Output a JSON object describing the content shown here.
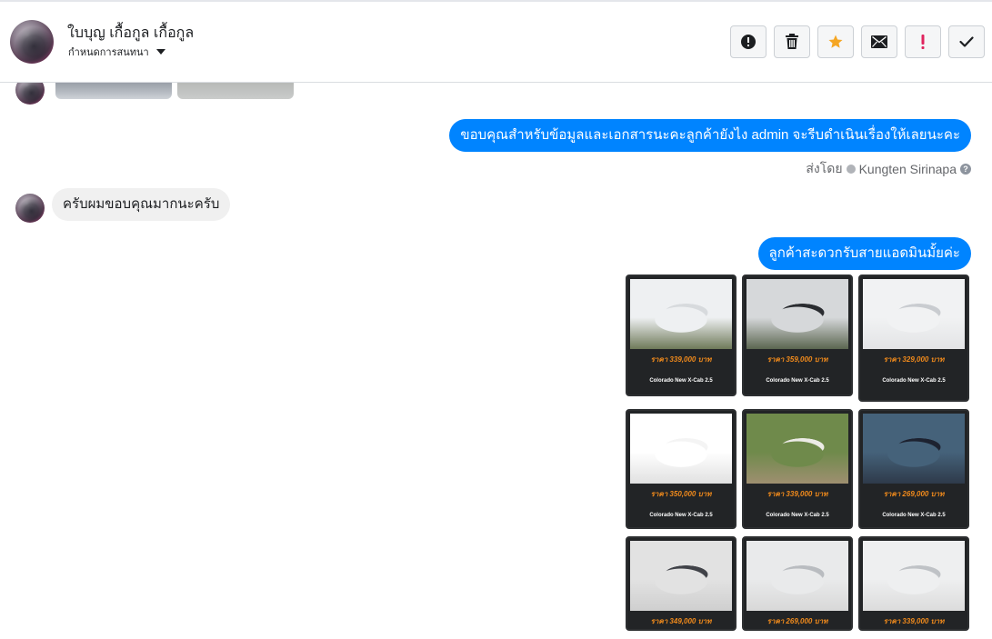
{
  "header": {
    "contact_name": "ใบบุญ เกื้อกูล เกื้อกูล",
    "assign_label": "กำหนดการสนทนา",
    "actions": [
      {
        "name": "report-button",
        "icon": "exclamation-circle-icon",
        "color": "#1c1e21"
      },
      {
        "name": "delete-button",
        "icon": "trash-icon",
        "color": "#1c1e21"
      },
      {
        "name": "star-button",
        "icon": "star-icon",
        "color": "#f5a623"
      },
      {
        "name": "mark-unread-button",
        "icon": "envelope-icon",
        "color": "#1c1e21"
      },
      {
        "name": "priority-button",
        "icon": "exclamation-icon",
        "color": "#e0245e"
      },
      {
        "name": "done-button",
        "icon": "check-icon",
        "color": "#1c1e21"
      }
    ]
  },
  "messages": {
    "outgoing_1": "ขอบคุณสำหรับข้อมูลและเอกสารนะคะลูกค้ายังไง admin จะรีบดำเนินเรื่องให้เลยนะคะ",
    "sent_by_prefix": "ส่งโดย",
    "sent_by_name": "Kungten Sirinapa",
    "incoming_1": "ครับผมขอบคุณมากนะครับ",
    "outgoing_2": "ลูกค้าสะดวกรับสายแอดมินมั้ยค่ะ"
  },
  "car_cards": [
    {
      "price": "ราคา 339,000 บาท",
      "model": "Colorado New X-Cab 2.5",
      "photo_colors": [
        "#d7dadd",
        "#eef0f2",
        "#6f7a5a"
      ]
    },
    {
      "price": "ราคา 359,000 บาท",
      "model": "Colorado New X-Cab 2.5",
      "photo_colors": [
        "#2a2c30",
        "#d6d8da",
        "#5b6650"
      ]
    },
    {
      "price": "ราคา 329,000 บาท",
      "model": "Colorado New X-Cab 2.5",
      "photo_colors": [
        "#c9ccd0",
        "#f1f2f3",
        "#e3e4e6"
      ]
    },
    {
      "price": "ราคา 350,000 บาท",
      "model": "Colorado New X-Cab 2.5",
      "photo_colors": [
        "#f4f4f4",
        "#ffffff",
        "#e1e1e1"
      ]
    },
    {
      "price": "ราคา 339,000 บาท",
      "model": "Colorado New X-Cab 2.5",
      "photo_colors": [
        "#ecebe6",
        "#6f8a4b",
        "#9e8f70"
      ]
    },
    {
      "price": "ราคา 269,000 บาท",
      "model": "Colorado New X-Cab 2.5",
      "photo_colors": [
        "#1d2230",
        "#45627a",
        "#2e3a4a"
      ]
    },
    {
      "price": "ราคา 349,000 บาท",
      "model": "",
      "photo_colors": [
        "#404248",
        "#e2e2e2",
        "#cfcfcf"
      ]
    },
    {
      "price": "ราคา 269,000 บาท",
      "model": "",
      "photo_colors": [
        "#b9bcc0",
        "#e9eaeb",
        "#d8d8d8"
      ]
    },
    {
      "price": "ราคา 339,000 บาท",
      "model": "",
      "photo_colors": [
        "#bfc2c6",
        "#eeeff0",
        "#dcdcdc"
      ]
    }
  ],
  "colors": {
    "outgoing_bubble": "#0084ff",
    "incoming_bubble": "#f0f0f0",
    "price_text": "#f08a1c",
    "card_bg": "#222426"
  }
}
